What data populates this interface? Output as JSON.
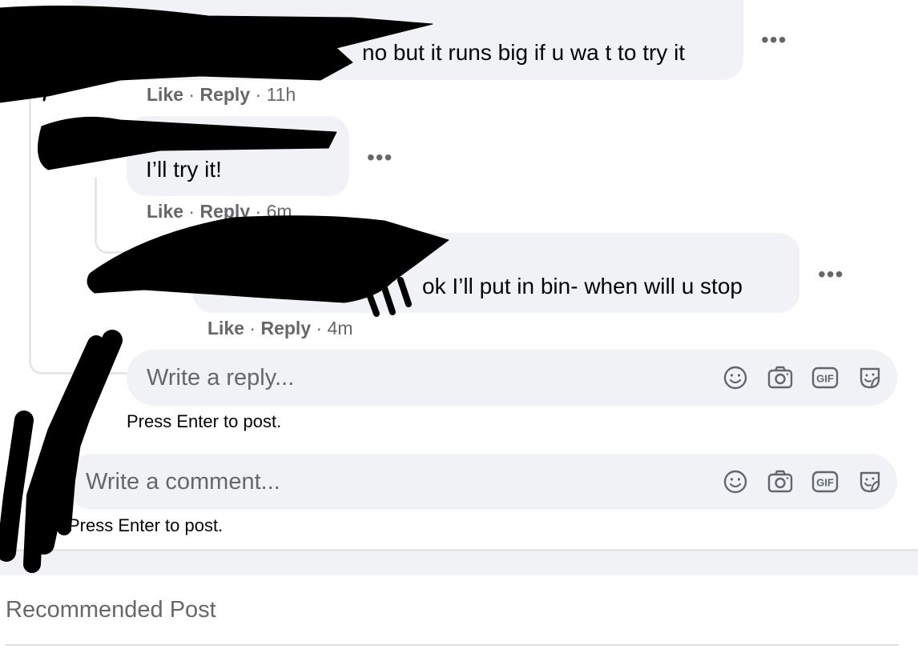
{
  "comments": [
    {
      "text": "no but it runs big if u wa t to try it",
      "like": "Like",
      "reply": "Reply",
      "time": "11h",
      "more": "•••"
    },
    {
      "text": "I’ll try it!",
      "like": "Like",
      "reply": "Reply",
      "time": "6m",
      "more": "•••"
    },
    {
      "text": "ok I’ll put in bin- when will u stop",
      "like": "Like",
      "reply": "Reply",
      "time": "4m",
      "more": "•••"
    }
  ],
  "reply_box": {
    "placeholder": "Write a reply...",
    "hint": "Press Enter to post."
  },
  "comment_box": {
    "placeholder": "Write a comment...",
    "hint": "Press Enter to post."
  },
  "sep": "·",
  "section_title": "Recommended Post",
  "icons": [
    "emoji-icon",
    "camera-icon",
    "gif-icon",
    "sticker-icon"
  ],
  "colors": {
    "bubble": "#f0f2f5",
    "meta": "#65676b",
    "text": "#050505",
    "redaction": "#000000"
  }
}
